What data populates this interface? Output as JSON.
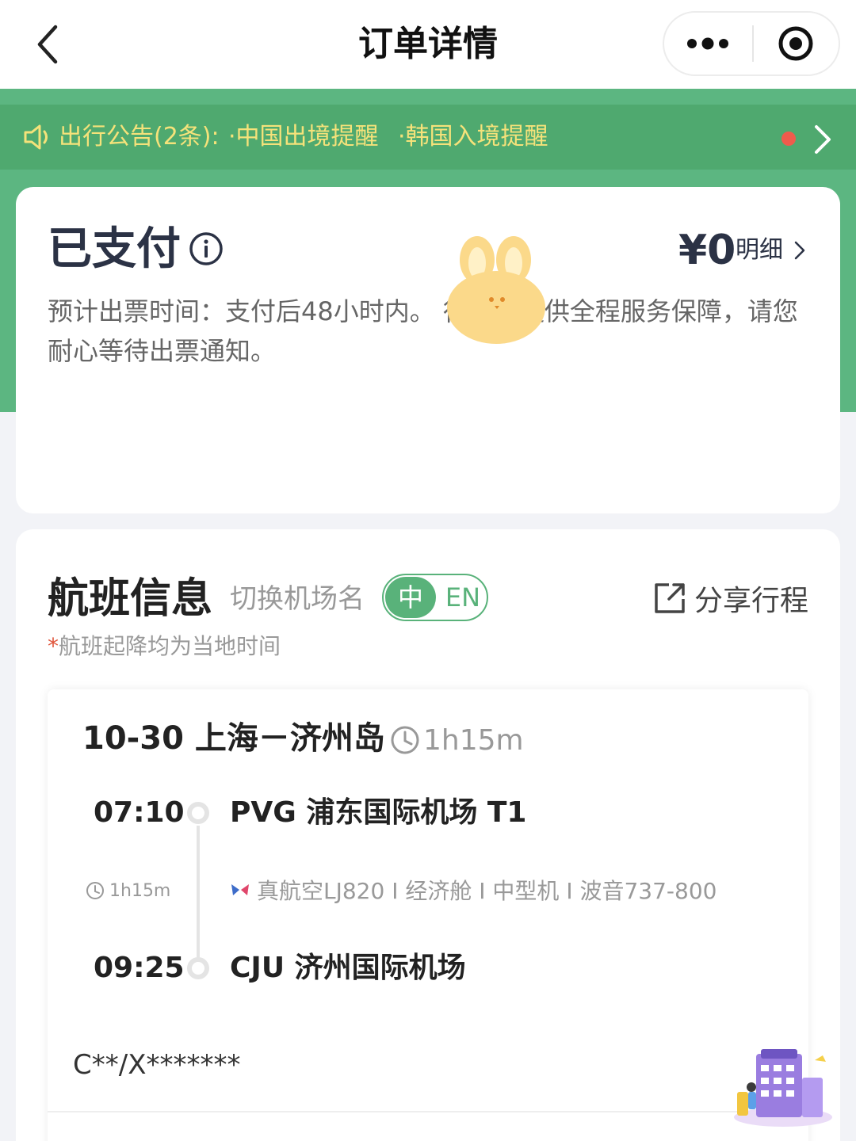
{
  "header": {
    "title": "订单详情"
  },
  "notice": {
    "label": "出行公告(2条):",
    "items": [
      "·中国出境提醒",
      "·韩国入境提醒"
    ]
  },
  "status": {
    "title": "已支付",
    "price": "¥0",
    "price_detail": "明细",
    "description": "预计出票时间：支付后48小时内。 行为您提供全程服务保障，请您耐心等待出票通知。"
  },
  "flight": {
    "section_title": "航班信息",
    "switch_label": "切换机场名",
    "lang_zh": "中",
    "lang_en": "EN",
    "share_label": "分享行程",
    "local_note_star": "*",
    "local_note": "航班起降均为当地时间",
    "segment": {
      "date_route": "10-30 上海－济州岛",
      "duration": "1h15m",
      "depart_time": "07:10",
      "depart_airport": "PVG 浦东国际机场 T1",
      "mid_duration": "1h15m",
      "flight_meta": "真航空LJ820 I 经济舱 I 中型机 I 波音737-800",
      "arrive_time": "09:25",
      "arrive_airport": "CJU 济州国际机场",
      "passenger": "C**/X*******"
    }
  },
  "colors": {
    "brand_green": "#5cb681",
    "notice_text": "#f5e27a",
    "alert_dot": "#ef5b4c"
  },
  "icons": [
    "back-arrow-icon",
    "more-dots-icon",
    "target-close-icon",
    "speaker-icon",
    "chevron-right-icon",
    "info-icon",
    "share-icon",
    "clock-icon",
    "airline-logo-icon",
    "hotel-icon"
  ]
}
